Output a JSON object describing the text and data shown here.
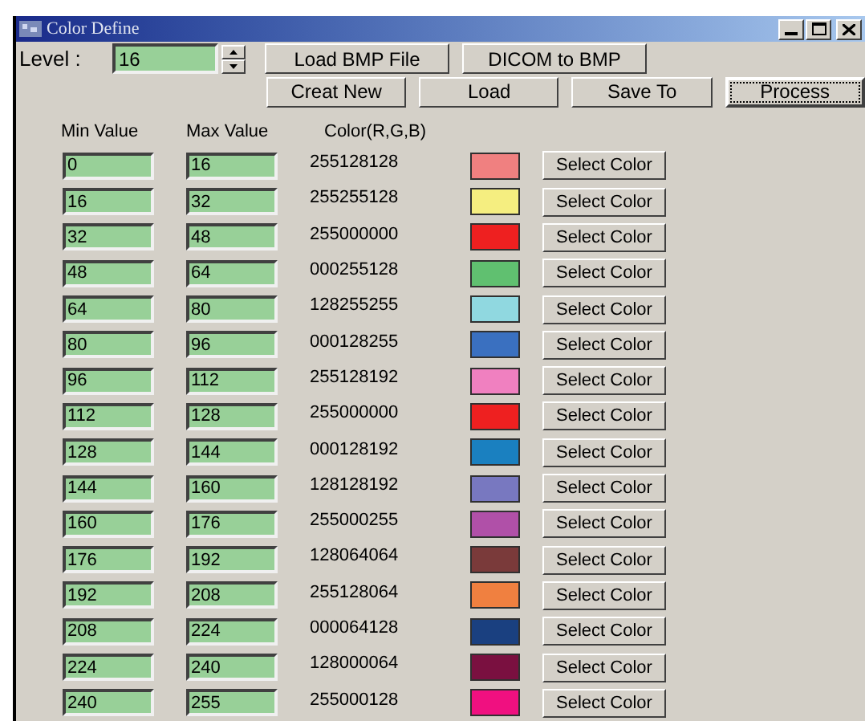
{
  "window": {
    "title": "Color Define"
  },
  "level": {
    "label": "Level :",
    "value": "16"
  },
  "top_buttons": [
    {
      "label": "Load BMP File",
      "focused": false
    },
    {
      "label": "DICOM to BMP",
      "focused": false
    }
  ],
  "action_buttons": [
    {
      "label": "Creat New",
      "focused": false
    },
    {
      "label": "Load",
      "focused": false
    },
    {
      "label": "Save To",
      "focused": false
    },
    {
      "label": "Process",
      "focused": true
    }
  ],
  "table": {
    "columns": [
      "Min Value",
      "Max Value",
      "Color(R,G,B)"
    ],
    "rows": [
      {
        "min": "0",
        "max": "16",
        "rgb": "255128128",
        "color": "#f08080",
        "button": "Select Color"
      },
      {
        "min": "16",
        "max": "32",
        "rgb": "255255128",
        "color": "#f5ee80",
        "button": "Select Color"
      },
      {
        "min": "32",
        "max": "48",
        "rgb": "255000000",
        "color": "#ee2020",
        "button": "Select Color"
      },
      {
        "min": "48",
        "max": "64",
        "rgb": "000255128",
        "color": "#60c070",
        "button": "Select Color"
      },
      {
        "min": "64",
        "max": "80",
        "rgb": "128255255",
        "color": "#90d8e0",
        "button": "Select Color"
      },
      {
        "min": "80",
        "max": "96",
        "rgb": "000128255",
        "color": "#3a70c0",
        "button": "Select Color"
      },
      {
        "min": "96",
        "max": "112",
        "rgb": "255128192",
        "color": "#f080c0",
        "button": "Select Color"
      },
      {
        "min": "112",
        "max": "128",
        "rgb": "255000000",
        "color": "#ee2020",
        "button": "Select Color"
      },
      {
        "min": "128",
        "max": "144",
        "rgb": "000128192",
        "color": "#1a80c0",
        "button": "Select Color"
      },
      {
        "min": "144",
        "max": "160",
        "rgb": "128128192",
        "color": "#7878c0",
        "button": "Select Color"
      },
      {
        "min": "160",
        "max": "176",
        "rgb": "255000255",
        "color": "#b050a8",
        "button": "Select Color"
      },
      {
        "min": "176",
        "max": "192",
        "rgb": "128064064",
        "color": "#7a3a3a",
        "button": "Select Color"
      },
      {
        "min": "192",
        "max": "208",
        "rgb": "255128064",
        "color": "#f08040",
        "button": "Select Color"
      },
      {
        "min": "208",
        "max": "224",
        "rgb": "000064128",
        "color": "#1a4080",
        "button": "Select Color"
      },
      {
        "min": "224",
        "max": "240",
        "rgb": "128000064",
        "color": "#7a1040",
        "button": "Select Color"
      },
      {
        "min": "240",
        "max": "255",
        "rgb": "255000128",
        "color": "#f01080",
        "button": "Select Color"
      }
    ]
  }
}
